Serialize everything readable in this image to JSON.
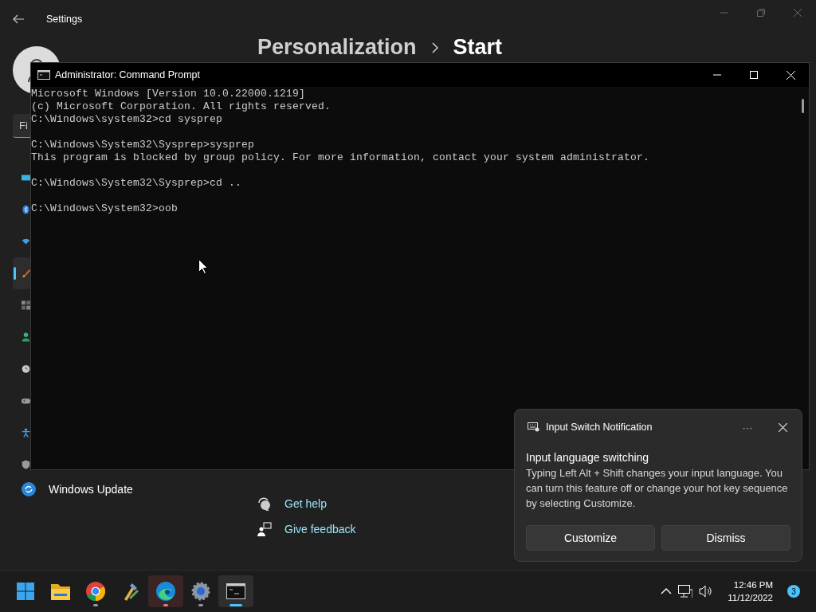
{
  "settings_window": {
    "title": "Settings",
    "search": {
      "placeholder": "Fi"
    },
    "breadcrumb": [
      "Personalization",
      "Start"
    ],
    "nav_items": [
      {
        "kind": "display",
        "selected": false
      },
      {
        "kind": "bluetooth",
        "selected": false
      },
      {
        "kind": "wifi",
        "selected": false
      },
      {
        "kind": "brush",
        "selected": true
      },
      {
        "kind": "apps",
        "selected": false
      },
      {
        "kind": "person",
        "selected": false
      },
      {
        "kind": "clock",
        "selected": false
      },
      {
        "kind": "gamepad",
        "selected": false
      },
      {
        "kind": "accessibility",
        "selected": false
      },
      {
        "kind": "shield",
        "selected": false
      }
    ],
    "nav_footer": {
      "kind": "update",
      "label": "Windows Update"
    },
    "links": [
      {
        "kind": "help",
        "label": "Get help"
      },
      {
        "kind": "feedback",
        "label": "Give feedback"
      }
    ]
  },
  "console_window": {
    "title": "Administrator: Command Prompt",
    "blocks": [
      [
        "Microsoft Windows [Version 10.0.22000.1219]",
        "(c) Microsoft Corporation. All rights reserved.",
        "C:\\Windows\\system32>cd sysprep"
      ],
      [
        "C:\\Windows\\System32\\Sysprep>sysprep",
        "This program is blocked by group policy. For more information, contact your system administrator."
      ],
      [
        "C:\\Windows\\System32\\Sysprep>cd .."
      ],
      [
        "C:\\Windows\\System32>oob"
      ]
    ]
  },
  "notification": {
    "app": "Input Switch Notification",
    "more": "···",
    "title": "Input language switching",
    "body": "Typing Left Alt + Shift changes your input language. You can turn this feature off or change your hot key sequence by selecting Customize.",
    "buttons": [
      "Customize",
      "Dismiss"
    ]
  },
  "taskbar": {
    "apps": [
      {
        "kind": "start",
        "running": false,
        "selected": false,
        "attention": false
      },
      {
        "kind": "folder",
        "running": false,
        "selected": false,
        "attention": false
      },
      {
        "kind": "ring",
        "running": true,
        "selected": false,
        "attention": false
      },
      {
        "kind": "tools",
        "running": false,
        "selected": false,
        "attention": false
      },
      {
        "kind": "wave",
        "running": true,
        "selected": false,
        "attention": true
      },
      {
        "kind": "gear",
        "running": true,
        "selected": false,
        "attention": false
      },
      {
        "kind": "terminal",
        "running": true,
        "selected": true,
        "attention": false
      }
    ],
    "time": "12:46 PM",
    "date": "11/12/2022",
    "badge": "3"
  }
}
